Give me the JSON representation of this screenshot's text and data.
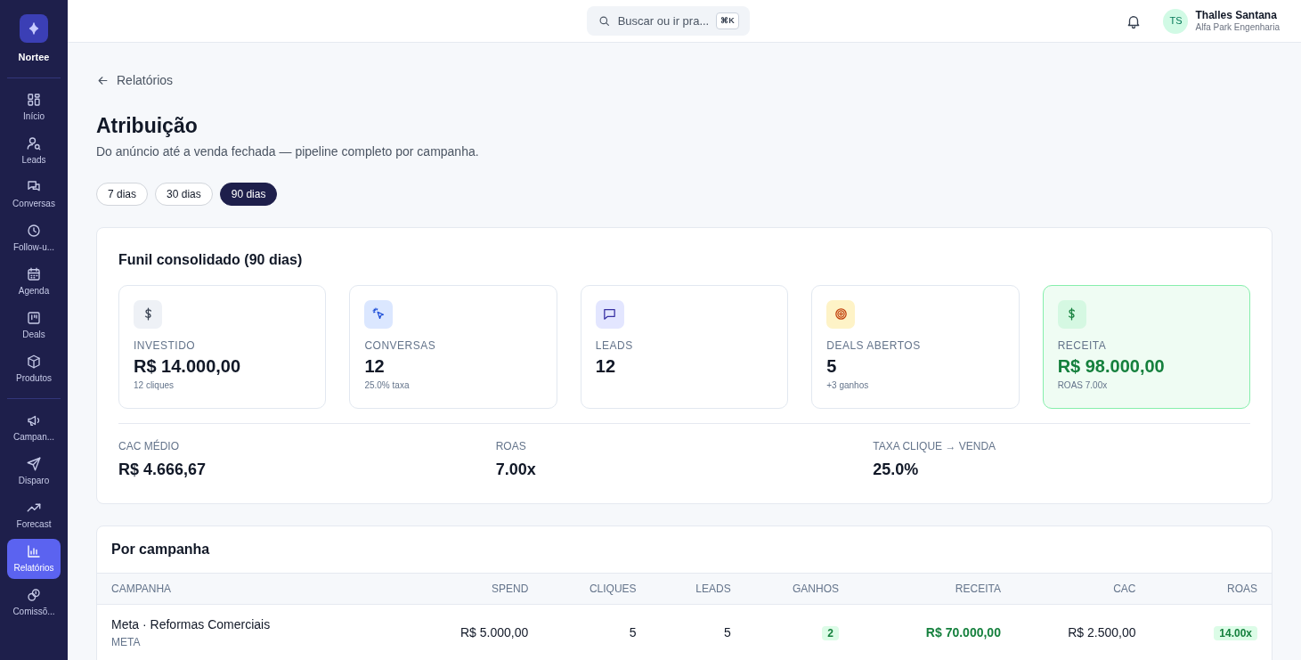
{
  "brand": {
    "name": "Nortee"
  },
  "sidebar": {
    "sections": [
      {
        "items": [
          {
            "label": "Início",
            "selected": false
          },
          {
            "label": "Leads",
            "selected": false
          },
          {
            "label": "Conversas",
            "selected": false
          },
          {
            "label": "Follow-u...",
            "selected": false
          },
          {
            "label": "Agenda",
            "selected": false
          },
          {
            "label": "Deals",
            "selected": false
          },
          {
            "label": "Produtos",
            "selected": false
          }
        ]
      },
      {
        "items": [
          {
            "label": "Campan...",
            "selected": false
          },
          {
            "label": "Disparo",
            "selected": false
          },
          {
            "label": "Forecast",
            "selected": false
          },
          {
            "label": "Relatórios",
            "selected": true
          },
          {
            "label": "Comissõ...",
            "selected": false
          }
        ]
      }
    ]
  },
  "topbar": {
    "search": {
      "placeholder": "Buscar ou ir pra...",
      "shortcut": "⌘K"
    },
    "user": {
      "initials": "TS",
      "name": "Thalles Santana",
      "company": "Alfa Park Engenharia"
    }
  },
  "back_link": "Relatórios",
  "title": "Atribuição",
  "subtitle": "Do anúncio até a venda fechada — pipeline completo por campanha.",
  "ranges": [
    {
      "label": "7 dias",
      "selected": false
    },
    {
      "label": "30 dias",
      "selected": false
    },
    {
      "label": "90 dias",
      "selected": true
    }
  ],
  "funnel": {
    "title": "Funil consolidado (90 dias)",
    "cards": [
      {
        "label": "INVESTIDO",
        "value": "R$ 14.000,00",
        "note": "12 cliques",
        "highlighted": false
      },
      {
        "label": "CONVERSAS",
        "value": "12",
        "note": "25.0% taxa",
        "highlighted": false
      },
      {
        "label": "LEADS",
        "value": "12",
        "highlighted": false
      },
      {
        "label": "DEALS ABERTOS",
        "value": "5",
        "note": "+3 ganhos",
        "highlighted": false
      },
      {
        "label": "RECEITA",
        "value": "R$ 98.000,00",
        "note": "ROAS 7.00x",
        "highlighted": true
      }
    ],
    "metrics": [
      {
        "label": "CAC MÉDIO",
        "value": "R$ 4.666,67"
      },
      {
        "label": "ROAS",
        "value": "7.00x"
      },
      {
        "label": "TAXA CLIQUE → VENDA",
        "value": "25.0%"
      }
    ]
  },
  "campaigns": {
    "title": "Por campanha",
    "columns": [
      "CAMPANHA",
      "SPEND",
      "CLIQUES",
      "LEADS",
      "GANHOS",
      "RECEITA",
      "CAC",
      "ROAS"
    ],
    "rows": [
      {
        "name": "Meta · Reformas Comerciais",
        "source": "META",
        "spend": "R$ 5.000,00",
        "cliques": "5",
        "leads": "5",
        "ganhos": "2",
        "receita": "R$ 70.000,00",
        "cac": "R$ 2.500,00",
        "roas": "14.00x"
      }
    ]
  }
}
